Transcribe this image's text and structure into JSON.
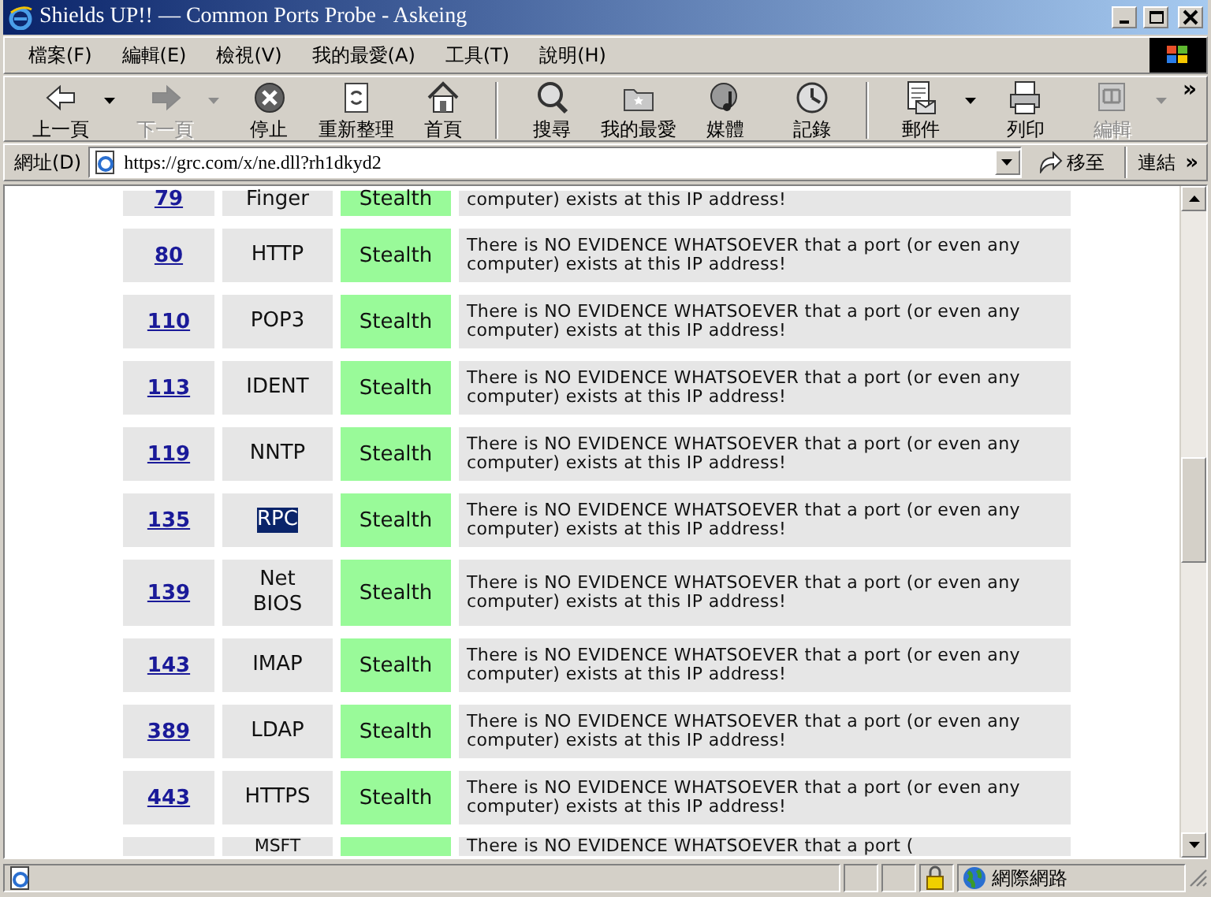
{
  "window": {
    "title": "Shields UP!! — Common Ports Probe - Askeing"
  },
  "menu": [
    {
      "label": "檔案(F)"
    },
    {
      "label": "編輯(E)"
    },
    {
      "label": "檢視(V)"
    },
    {
      "label": "我的最愛(A)"
    },
    {
      "label": "工具(T)"
    },
    {
      "label": "說明(H)"
    }
  ],
  "toolbar": {
    "more": "»",
    "buttons": [
      {
        "kind": "back",
        "label": "上一頁",
        "disabled": false,
        "dropdown": true,
        "separator_before": false
      },
      {
        "kind": "forward",
        "label": "下一頁",
        "disabled": true,
        "dropdown": true,
        "separator_before": false
      },
      {
        "kind": "stop",
        "label": "停止",
        "disabled": false,
        "dropdown": false,
        "separator_before": false
      },
      {
        "kind": "refresh",
        "label": "重新整理",
        "disabled": false,
        "dropdown": false,
        "separator_before": false
      },
      {
        "kind": "home",
        "label": "首頁",
        "disabled": false,
        "dropdown": false,
        "separator_before": false
      },
      {
        "kind": "search",
        "label": "搜尋",
        "disabled": false,
        "dropdown": false,
        "separator_before": true
      },
      {
        "kind": "favorites",
        "label": "我的最愛",
        "disabled": false,
        "dropdown": false,
        "separator_before": false
      },
      {
        "kind": "media",
        "label": "媒體",
        "disabled": false,
        "dropdown": false,
        "separator_before": false
      },
      {
        "kind": "history",
        "label": "記錄",
        "disabled": false,
        "dropdown": false,
        "separator_before": false
      },
      {
        "kind": "mail",
        "label": "郵件",
        "disabled": false,
        "dropdown": true,
        "separator_before": true
      },
      {
        "kind": "print",
        "label": "列印",
        "disabled": false,
        "dropdown": false,
        "separator_before": false
      },
      {
        "kind": "edit",
        "label": "編輯",
        "disabled": true,
        "dropdown": true,
        "separator_before": false
      }
    ]
  },
  "address_bar": {
    "label": "網址(D)",
    "url": "https://grc.com/x/ne.dll?rh1dkyd2",
    "go": "移至",
    "links": "連結",
    "links_more": "»"
  },
  "ports": [
    {
      "kind": "cut-top",
      "port": "79",
      "service": "Finger",
      "status": "Stealth",
      "message": "computer) exists at this IP address!",
      "highlighted": false
    },
    {
      "kind": "full",
      "port": "80",
      "service": "HTTP",
      "status": "Stealth",
      "message": "There is NO EVIDENCE WHATSOEVER that a port (or even any computer) exists at this IP address!",
      "highlighted": false
    },
    {
      "kind": "full",
      "port": "110",
      "service": "POP3",
      "status": "Stealth",
      "message": "There is NO EVIDENCE WHATSOEVER that a port (or even any computer) exists at this IP address!",
      "highlighted": false
    },
    {
      "kind": "full",
      "port": "113",
      "service": "IDENT",
      "status": "Stealth",
      "message": "There is NO EVIDENCE WHATSOEVER that a port (or even any computer) exists at this IP address!",
      "highlighted": false
    },
    {
      "kind": "full",
      "port": "119",
      "service": "NNTP",
      "status": "Stealth",
      "message": "There is NO EVIDENCE WHATSOEVER that a port (or even any computer) exists at this IP address!",
      "highlighted": false
    },
    {
      "kind": "full",
      "port": "135",
      "service": "RPC",
      "status": "Stealth",
      "message": "There is NO EVIDENCE WHATSOEVER that a port (or even any computer) exists at this IP address!",
      "highlighted": true
    },
    {
      "kind": "full",
      "port": "139",
      "service": "Net BIOS",
      "status": "Stealth",
      "message": "There is NO EVIDENCE WHATSOEVER that a port (or even any computer) exists at this IP address!",
      "highlighted": false
    },
    {
      "kind": "full",
      "port": "143",
      "service": "IMAP",
      "status": "Stealth",
      "message": "There is NO EVIDENCE WHATSOEVER that a port (or even any computer) exists at this IP address!",
      "highlighted": false
    },
    {
      "kind": "full",
      "port": "389",
      "service": "LDAP",
      "status": "Stealth",
      "message": "There is NO EVIDENCE WHATSOEVER that a port (or even any computer) exists at this IP address!",
      "highlighted": false
    },
    {
      "kind": "full",
      "port": "443",
      "service": "HTTPS",
      "status": "Stealth",
      "message": "There is NO EVIDENCE WHATSOEVER that a port (or even any computer) exists at this IP address!",
      "highlighted": false
    },
    {
      "kind": "cut-bottom",
      "service": "MSFT",
      "message": "There is NO EVIDENCE WHATSOEVER that a port (",
      "highlighted": false
    }
  ],
  "status_bar": {
    "zone": "網際網路",
    "secure": true
  }
}
